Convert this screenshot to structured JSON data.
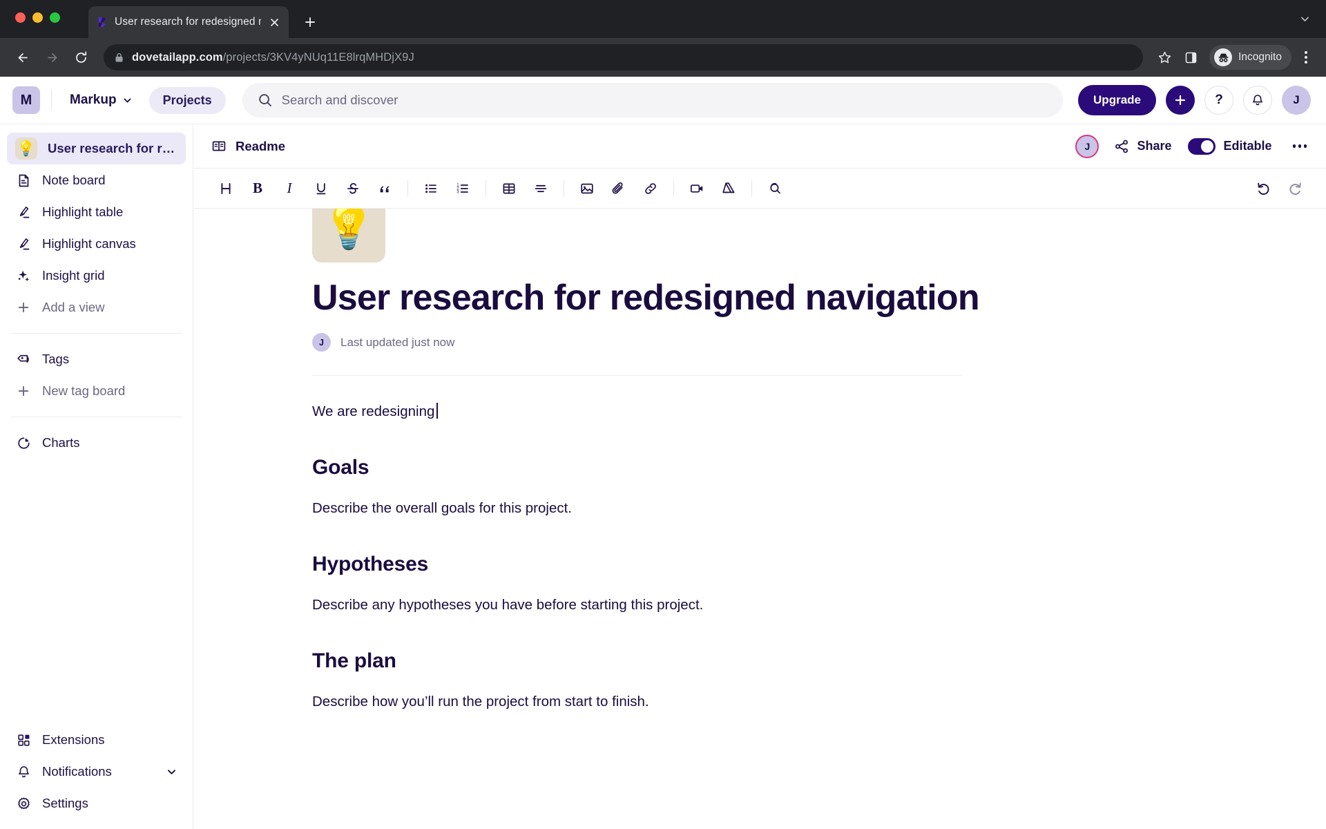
{
  "browser": {
    "tab": {
      "title": "User research for redesigned n",
      "favicon": "dovetail-logo-icon",
      "close_icon": "close-icon"
    },
    "new_tab_icon": "plus-icon",
    "tab_list_icon": "chevron-down-icon",
    "back_icon": "back-arrow-icon",
    "forward_icon": "forward-arrow-icon",
    "reload_icon": "reload-icon",
    "lock_icon": "lock-icon",
    "url_host": "dovetailapp.com",
    "url_path": "/projects/3KV4yNUq11E8lrqMHDjX9J",
    "bookmark_icon": "star-icon",
    "sidepanel_icon": "side-panel-icon",
    "incognito_icon": "incognito-icon",
    "incognito_label": "Incognito",
    "menu_icon": "kebab-menu-icon"
  },
  "header": {
    "workspace_initial": "M",
    "workspace_name": "Markup",
    "workspace_chevron": "chevron-down-icon",
    "projects_label": "Projects",
    "search_icon": "search-icon",
    "search_placeholder": "Search and discover",
    "upgrade_label": "Upgrade",
    "create_icon": "plus-icon",
    "help_icon": "question-mark-icon",
    "notifications_icon": "bell-icon",
    "user_initial": "J"
  },
  "sidebar": {
    "project": {
      "emoji": "💡",
      "label": "User research for rede...",
      "icon": "lightbulb-icon"
    },
    "views": [
      {
        "label": "Note board",
        "icon": "note-icon"
      },
      {
        "label": "Highlight table",
        "icon": "highlighter-icon"
      },
      {
        "label": "Highlight canvas",
        "icon": "highlighter-icon"
      },
      {
        "label": "Insight grid",
        "icon": "sparkle-icon"
      }
    ],
    "add_view_label": "Add a view",
    "add_view_icon": "plus-icon",
    "tags_label": "Tags",
    "tags_icon": "tag-icon",
    "new_tag_board_label": "New tag board",
    "new_tag_board_icon": "plus-icon",
    "charts_label": "Charts",
    "charts_icon": "pie-chart-icon",
    "bottom": [
      {
        "label": "Extensions",
        "icon": "extensions-icon"
      },
      {
        "label": "Notifications",
        "icon": "bell-icon",
        "chevron": "chevron-down-icon"
      },
      {
        "label": "Settings",
        "icon": "gear-icon"
      }
    ]
  },
  "doc_header": {
    "tab_label": "Readme",
    "tab_icon": "book-icon",
    "collaborator_initial": "J",
    "share_label": "Share",
    "share_icon": "share-icon",
    "editable_label": "Editable",
    "editable_on": true,
    "more_icon": "ellipsis-icon"
  },
  "editor_toolbar": {
    "groups": [
      [
        {
          "name": "heading",
          "icon": "heading-icon",
          "glyph": "H"
        },
        {
          "name": "bold",
          "icon": "bold-icon",
          "glyph": "B"
        },
        {
          "name": "italic",
          "icon": "italic-icon",
          "glyph": "I"
        },
        {
          "name": "underline",
          "icon": "underline-icon",
          "glyph": "U"
        },
        {
          "name": "strikethrough",
          "icon": "strikethrough-icon",
          "glyph": "S"
        },
        {
          "name": "blockquote",
          "icon": "quote-icon",
          "glyph": "”"
        }
      ],
      [
        {
          "name": "bulleted-list",
          "icon": "bulleted-list-icon"
        },
        {
          "name": "numbered-list",
          "icon": "numbered-list-icon"
        }
      ],
      [
        {
          "name": "table",
          "icon": "table-icon"
        },
        {
          "name": "divider",
          "icon": "divider-icon"
        }
      ],
      [
        {
          "name": "image",
          "icon": "image-icon"
        },
        {
          "name": "attachment",
          "icon": "paperclip-icon"
        },
        {
          "name": "link",
          "icon": "link-icon"
        }
      ],
      [
        {
          "name": "video",
          "icon": "video-icon"
        },
        {
          "name": "google-drive",
          "icon": "google-drive-icon"
        }
      ],
      [
        {
          "name": "search-replace",
          "icon": "search-loop-icon"
        }
      ]
    ],
    "undo_icon": "undo-icon",
    "redo_icon": "redo-icon"
  },
  "document": {
    "cover_emoji": "💡",
    "title": "User research for redesigned navigation",
    "author_initial": "J",
    "last_updated": "Last updated just now",
    "intro": "We are redesigning",
    "sections": [
      {
        "heading": "Goals",
        "body": "Describe the overall goals for this project."
      },
      {
        "heading": "Hypotheses",
        "body": "Describe any hypotheses you have before starting this project."
      },
      {
        "heading": "The plan",
        "body": "Describe how you’ll run the project from start to finish."
      }
    ]
  },
  "colors": {
    "brand_purple": "#2b0b7a",
    "ink": "#1b0c3f",
    "muted": "#6b6880",
    "sidebar_active": "#ebe8f7",
    "accent_pink": "#d9377f"
  }
}
